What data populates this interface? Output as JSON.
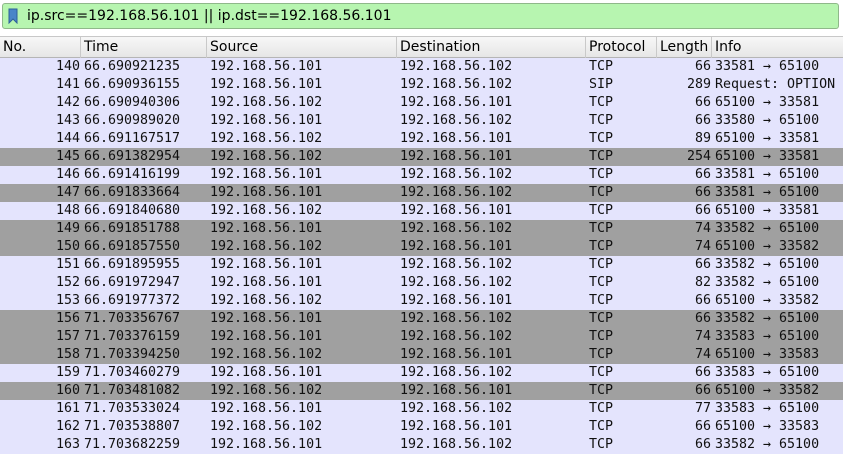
{
  "filter": {
    "expression": "ip.src==192.168.56.101 || ip.dst==192.168.56.101",
    "background_color": "#b7f5b0"
  },
  "columns": [
    "No.",
    "Time",
    "Source",
    "Destination",
    "Protocol",
    "Length",
    "Info"
  ],
  "row_colors": {
    "light": "#e4e4fd",
    "dark": "#a0a0a0"
  },
  "packets": [
    {
      "no": "140",
      "time": "66.690921235",
      "src": "192.168.56.101",
      "dst": "192.168.56.102",
      "proto": "TCP",
      "len": "66",
      "info": "33581 → 65100",
      "shade": "light"
    },
    {
      "no": "141",
      "time": "66.690936155",
      "src": "192.168.56.101",
      "dst": "192.168.56.102",
      "proto": "SIP",
      "len": "289",
      "info": "Request: OPTION",
      "shade": "light"
    },
    {
      "no": "142",
      "time": "66.690940306",
      "src": "192.168.56.102",
      "dst": "192.168.56.101",
      "proto": "TCP",
      "len": "66",
      "info": "65100 → 33581",
      "shade": "light"
    },
    {
      "no": "143",
      "time": "66.690989020",
      "src": "192.168.56.101",
      "dst": "192.168.56.102",
      "proto": "TCP",
      "len": "66",
      "info": "33580 → 65100",
      "shade": "light"
    },
    {
      "no": "144",
      "time": "66.691167517",
      "src": "192.168.56.102",
      "dst": "192.168.56.101",
      "proto": "TCP",
      "len": "89",
      "info": "65100 → 33581",
      "shade": "light"
    },
    {
      "no": "145",
      "time": "66.691382954",
      "src": "192.168.56.102",
      "dst": "192.168.56.101",
      "proto": "TCP",
      "len": "254",
      "info": "65100 → 33581",
      "shade": "dark"
    },
    {
      "no": "146",
      "time": "66.691416199",
      "src": "192.168.56.101",
      "dst": "192.168.56.102",
      "proto": "TCP",
      "len": "66",
      "info": "33581 → 65100",
      "shade": "light"
    },
    {
      "no": "147",
      "time": "66.691833664",
      "src": "192.168.56.101",
      "dst": "192.168.56.102",
      "proto": "TCP",
      "len": "66",
      "info": "33581 → 65100",
      "shade": "dark"
    },
    {
      "no": "148",
      "time": "66.691840680",
      "src": "192.168.56.102",
      "dst": "192.168.56.101",
      "proto": "TCP",
      "len": "66",
      "info": "65100 → 33581",
      "shade": "light"
    },
    {
      "no": "149",
      "time": "66.691851788",
      "src": "192.168.56.101",
      "dst": "192.168.56.102",
      "proto": "TCP",
      "len": "74",
      "info": "33582 → 65100",
      "shade": "dark"
    },
    {
      "no": "150",
      "time": "66.691857550",
      "src": "192.168.56.102",
      "dst": "192.168.56.101",
      "proto": "TCP",
      "len": "74",
      "info": "65100 → 33582",
      "shade": "dark"
    },
    {
      "no": "151",
      "time": "66.691895955",
      "src": "192.168.56.101",
      "dst": "192.168.56.102",
      "proto": "TCP",
      "len": "66",
      "info": "33582 → 65100",
      "shade": "light"
    },
    {
      "no": "152",
      "time": "66.691972947",
      "src": "192.168.56.101",
      "dst": "192.168.56.102",
      "proto": "TCP",
      "len": "82",
      "info": "33582 → 65100",
      "shade": "light"
    },
    {
      "no": "153",
      "time": "66.691977372",
      "src": "192.168.56.102",
      "dst": "192.168.56.101",
      "proto": "TCP",
      "len": "66",
      "info": "65100 → 33582",
      "shade": "light"
    },
    {
      "no": "156",
      "time": "71.703356767",
      "src": "192.168.56.101",
      "dst": "192.168.56.102",
      "proto": "TCP",
      "len": "66",
      "info": "33582 → 65100",
      "shade": "dark"
    },
    {
      "no": "157",
      "time": "71.703376159",
      "src": "192.168.56.101",
      "dst": "192.168.56.102",
      "proto": "TCP",
      "len": "74",
      "info": "33583 → 65100",
      "shade": "dark"
    },
    {
      "no": "158",
      "time": "71.703394250",
      "src": "192.168.56.102",
      "dst": "192.168.56.101",
      "proto": "TCP",
      "len": "74",
      "info": "65100 → 33583",
      "shade": "dark"
    },
    {
      "no": "159",
      "time": "71.703460279",
      "src": "192.168.56.101",
      "dst": "192.168.56.102",
      "proto": "TCP",
      "len": "66",
      "info": "33583 → 65100",
      "shade": "light"
    },
    {
      "no": "160",
      "time": "71.703481082",
      "src": "192.168.56.102",
      "dst": "192.168.56.101",
      "proto": "TCP",
      "len": "66",
      "info": "65100 → 33582",
      "shade": "dark"
    },
    {
      "no": "161",
      "time": "71.703533024",
      "src": "192.168.56.101",
      "dst": "192.168.56.102",
      "proto": "TCP",
      "len": "77",
      "info": "33583 → 65100",
      "shade": "light"
    },
    {
      "no": "162",
      "time": "71.703538807",
      "src": "192.168.56.102",
      "dst": "192.168.56.101",
      "proto": "TCP",
      "len": "66",
      "info": "65100 → 33583",
      "shade": "light"
    },
    {
      "no": "163",
      "time": "71.703682259",
      "src": "192.168.56.101",
      "dst": "192.168.56.102",
      "proto": "TCP",
      "len": "66",
      "info": "33582 → 65100",
      "shade": "light"
    }
  ]
}
